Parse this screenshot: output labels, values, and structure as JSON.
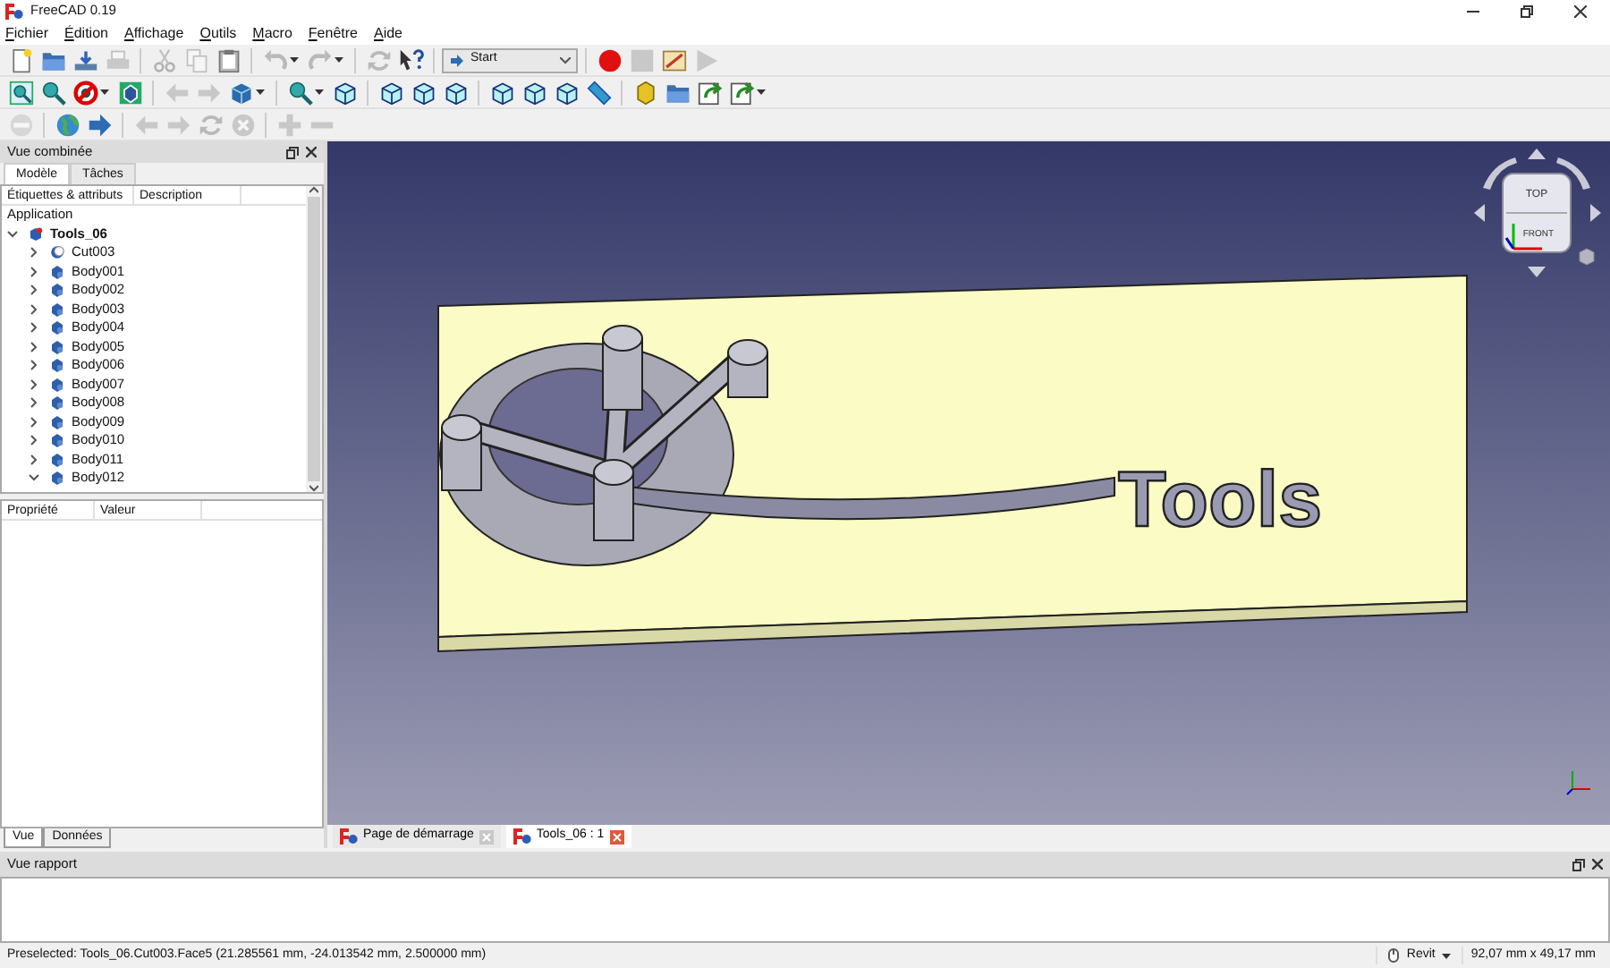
{
  "window": {
    "title": "FreeCAD 0.19"
  },
  "menu": [
    "Fichier",
    "Édition",
    "Affichage",
    "Outils",
    "Macro",
    "Fenêtre",
    "Aide"
  ],
  "toolbars": [
    [
      {
        "kind": "button",
        "disabled": false
      },
      {
        "kind": "button",
        "disabled": false
      },
      {
        "kind": "button",
        "disabled": false
      },
      {
        "kind": "button",
        "disabled": true
      },
      {
        "kind": "separator"
      },
      {
        "kind": "button",
        "disabled": true
      },
      {
        "kind": "button",
        "disabled": true
      },
      {
        "kind": "button",
        "disabled": false
      },
      {
        "kind": "separator"
      },
      {
        "kind": "button",
        "disabled": true,
        "dropdown": true
      },
      {
        "kind": "button",
        "disabled": true,
        "dropdown": true
      },
      {
        "kind": "separator"
      },
      {
        "kind": "button",
        "disabled": true
      },
      {
        "kind": "button",
        "disabled": false
      },
      {
        "kind": "separator"
      },
      {
        "kind": "combo",
        "value": "Start"
      },
      {
        "kind": "separator"
      },
      {
        "kind": "button",
        "disabled": false
      },
      {
        "kind": "button",
        "disabled": true
      },
      {
        "kind": "button",
        "disabled": false
      },
      {
        "kind": "button",
        "disabled": true
      }
    ],
    [
      {
        "kind": "button",
        "disabled": false
      },
      {
        "kind": "button",
        "disabled": false
      },
      {
        "kind": "button",
        "disabled": false,
        "dropdown": true
      },
      {
        "kind": "button",
        "disabled": false
      },
      {
        "kind": "separator"
      },
      {
        "kind": "button",
        "disabled": true
      },
      {
        "kind": "button",
        "disabled": true
      },
      {
        "kind": "button",
        "disabled": false,
        "dropdown": true
      },
      {
        "kind": "separator"
      },
      {
        "kind": "button",
        "disabled": false,
        "dropdown": true
      },
      {
        "kind": "button",
        "disabled": false
      },
      {
        "kind": "separator"
      },
      {
        "kind": "button",
        "disabled": false
      },
      {
        "kind": "button",
        "disabled": false
      },
      {
        "kind": "button",
        "disabled": false
      },
      {
        "kind": "separator"
      },
      {
        "kind": "button",
        "disabled": false
      },
      {
        "kind": "button",
        "disabled": false
      },
      {
        "kind": "button",
        "disabled": false
      },
      {
        "kind": "button",
        "disabled": false
      },
      {
        "kind": "separator"
      },
      {
        "kind": "button",
        "disabled": false
      },
      {
        "kind": "button",
        "disabled": false
      },
      {
        "kind": "button",
        "disabled": false
      },
      {
        "kind": "button",
        "disabled": false,
        "dropdown": true
      }
    ],
    [
      {
        "kind": "button",
        "disabled": true
      },
      {
        "kind": "separator"
      },
      {
        "kind": "button",
        "disabled": false
      },
      {
        "kind": "button",
        "disabled": false
      },
      {
        "kind": "separator"
      },
      {
        "kind": "button",
        "disabled": true
      },
      {
        "kind": "button",
        "disabled": true
      },
      {
        "kind": "button",
        "disabled": true
      },
      {
        "kind": "button",
        "disabled": true
      },
      {
        "kind": "separator"
      },
      {
        "kind": "button",
        "disabled": true
      },
      {
        "kind": "button",
        "disabled": true
      }
    ]
  ],
  "combo_view": {
    "title": "Vue combinée",
    "tabs": [
      {
        "label": "Modèle",
        "selected": true
      },
      {
        "label": "Tâches",
        "selected": false
      }
    ],
    "tree": {
      "columns": [
        "Étiquettes & attributs",
        "Description"
      ],
      "section": "Application",
      "items": [
        {
          "label": "Tools_06",
          "kind": "document",
          "expanded": true,
          "children": [
            {
              "label": "Cut003",
              "kind": "cut",
              "expanded": false
            },
            {
              "label": "Body001",
              "kind": "body",
              "expanded": false
            },
            {
              "label": "Body002",
              "kind": "body",
              "expanded": false
            },
            {
              "label": "Body003",
              "kind": "body",
              "expanded": false
            },
            {
              "label": "Body004",
              "kind": "body",
              "expanded": false
            },
            {
              "label": "Body005",
              "kind": "body",
              "expanded": false
            },
            {
              "label": "Body006",
              "kind": "body",
              "expanded": false
            },
            {
              "label": "Body007",
              "kind": "body",
              "expanded": false
            },
            {
              "label": "Body008",
              "kind": "body",
              "expanded": false
            },
            {
              "label": "Body009",
              "kind": "body",
              "expanded": false
            },
            {
              "label": "Body010",
              "kind": "body",
              "expanded": false
            },
            {
              "label": "Body011",
              "kind": "body",
              "expanded": false
            },
            {
              "label": "Body012",
              "kind": "body",
              "expanded": true
            }
          ]
        }
      ]
    },
    "property_columns": [
      "Propriété",
      "Valeur"
    ],
    "bottom_tabs": [
      {
        "label": "Vue",
        "selected": true
      },
      {
        "label": "Données",
        "selected": false
      }
    ]
  },
  "viewport": {
    "model_lettering": "Tools",
    "nav_cube": {
      "top": "TOP",
      "front": "FRONT"
    }
  },
  "document_tabs": [
    {
      "label": "Page de démarrage",
      "selected": false
    },
    {
      "label": "Tools_06 : 1",
      "selected": true
    }
  ],
  "report_view": {
    "title": "Vue rapport"
  },
  "status_bar": {
    "message": "Preselected: Tools_06.Cut003.Face5 (21.285561 mm, -24.013542 mm, 2.500000 mm)",
    "navigation_style": "Revit",
    "dimensions": "92,07 mm x 49,17 mm"
  }
}
